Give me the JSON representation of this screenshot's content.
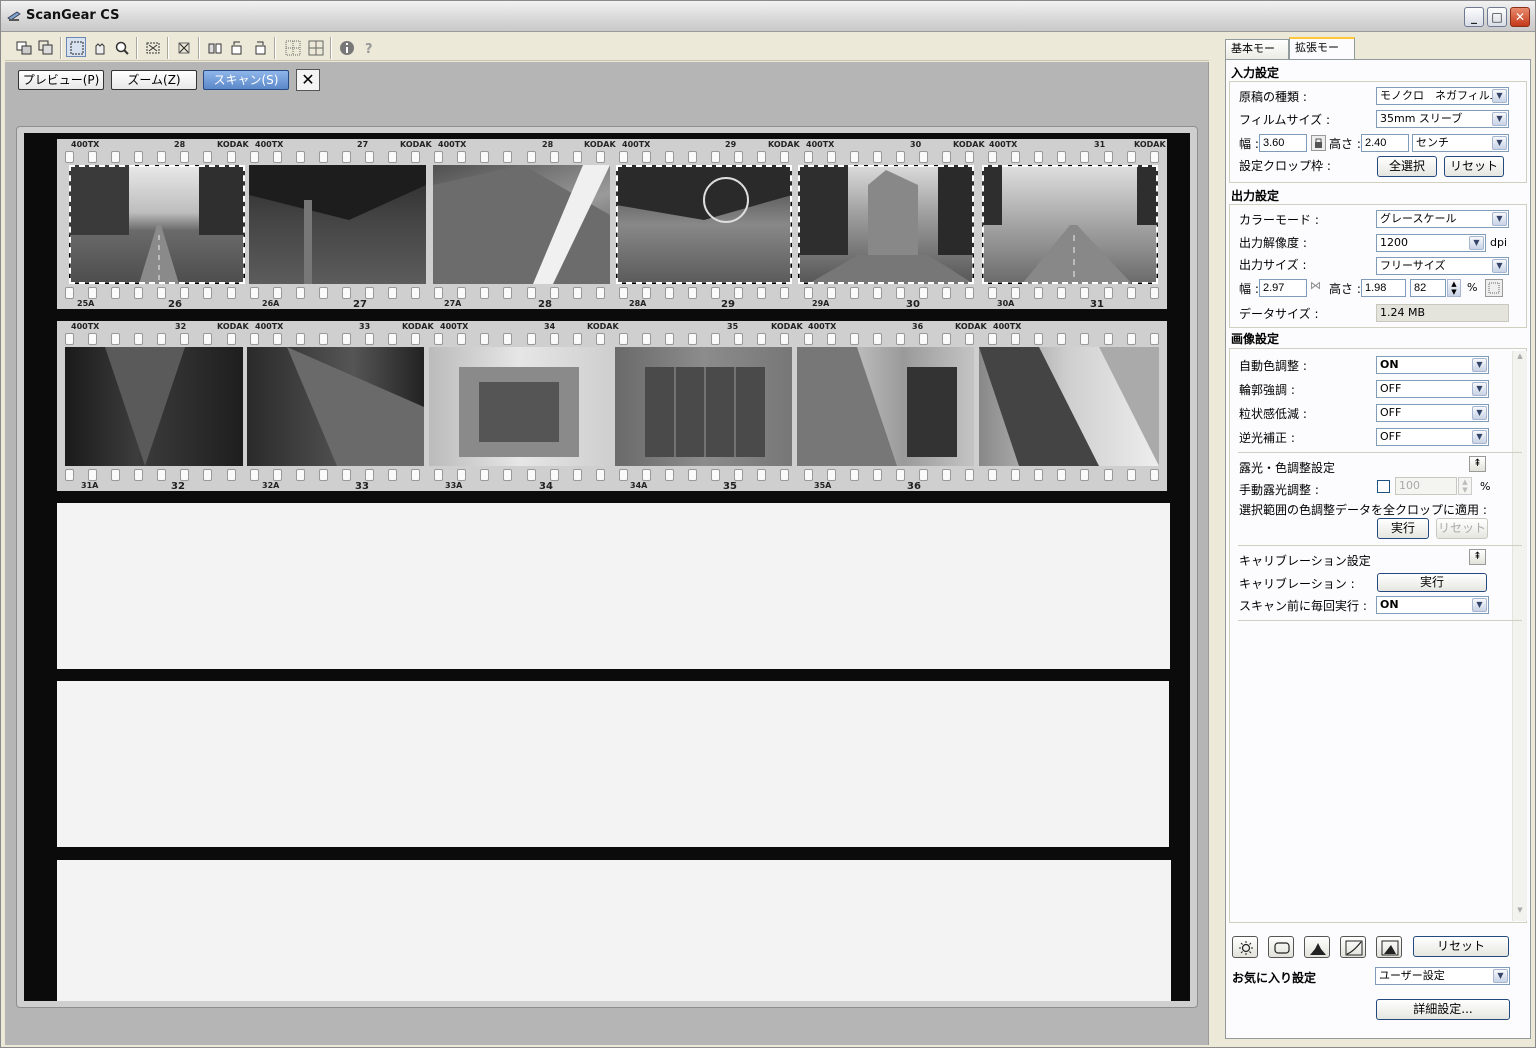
{
  "window": {
    "title": "ScanGear CS"
  },
  "actions": {
    "preview": "プレビュー(P)",
    "zoom": "ズーム(Z)",
    "scan": "スキャン(S)"
  },
  "film_edge": {
    "brand": "KODAK",
    "film": "400TX",
    "strip1_numbers": [
      "26",
      "27",
      "28",
      "29",
      "30",
      "31"
    ],
    "strip1_sub": [
      "25A",
      "26A",
      "27A",
      "28A",
      "29A",
      "30A"
    ],
    "strip1_top": [
      "28",
      "27",
      "28",
      "29",
      "30",
      "31"
    ],
    "strip2_numbers": [
      "32",
      "33",
      "34",
      "35",
      "36"
    ],
    "strip2_sub": [
      "31A",
      "32A",
      "33A",
      "34A",
      "35A"
    ]
  },
  "tabs": {
    "basic": "基本モード",
    "advanced": "拡張モード"
  },
  "input_settings": {
    "title": "入力設定",
    "doc_type_label": "原稿の種類 :",
    "doc_type_value": "モノクロ　ネガフィルム",
    "film_size_label": "フィルムサイズ :",
    "film_size_value": "35mm スリーブ",
    "width_label": "幅 :",
    "width_value": "3.60",
    "height_label": "高さ :",
    "height_value": "2.40",
    "unit_value": "センチ",
    "crop_label": "設定クロップ枠 :",
    "select_all": "全選択",
    "reset": "リセット"
  },
  "output_settings": {
    "title": "出力設定",
    "color_mode_label": "カラーモード :",
    "color_mode_value": "グレースケール",
    "resolution_label": "出力解像度 :",
    "resolution_value": "1200",
    "resolution_unit": "dpi",
    "size_label": "出力サイズ :",
    "size_value": "フリーサイズ",
    "width_label": "幅 :",
    "width_value": "2.97",
    "height_label": "高さ :",
    "height_value": "1.98",
    "scale_value": "82",
    "scale_unit": "%",
    "data_size_label": "データサイズ :",
    "data_size_value": "1.24 MB"
  },
  "image_settings": {
    "title": "画像設定",
    "auto_color_label": "自動色調整 :",
    "auto_color_value": "ON",
    "sharpen_label": "輪郭強調 :",
    "sharpen_value": "OFF",
    "grain_label": "粒状感低減 :",
    "grain_value": "OFF",
    "backlight_label": "逆光補正 :",
    "backlight_value": "OFF",
    "exposure_section": "露光・色調整設定",
    "manual_exposure_label": "手動露光調整 :",
    "manual_exposure_value": "100",
    "manual_exposure_unit": "%",
    "apply_label": "選択範囲の色調整データを全クロップに適用 :",
    "run": "実行",
    "reset": "リセット",
    "calibration_section": "キャリブレーション設定",
    "calibration_label": "キャリブレーション :",
    "calibration_run": "実行",
    "calibration_each_label": "スキャン前に毎回実行 :",
    "calibration_each_value": "ON"
  },
  "bottom": {
    "reset": "リセット",
    "favorites_label": "お気に入り設定",
    "favorites_value": "ユーザー設定",
    "details": "詳細設定..."
  }
}
